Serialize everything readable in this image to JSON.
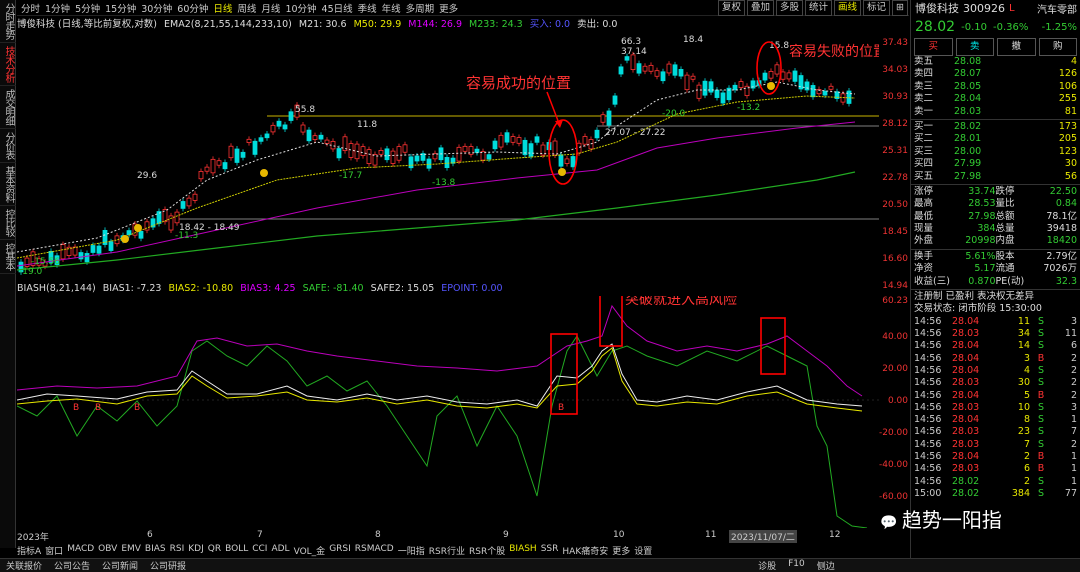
{
  "left_tabs": [
    "分时走势",
    "技术分析",
    "成交明细",
    "分价表",
    "基本资料",
    "控比较",
    "控基本"
  ],
  "top_bar": {
    "periods": [
      "分时",
      "1分钟",
      "5分钟",
      "15分钟",
      "30分钟",
      "60分钟",
      "日线",
      "周线",
      "月线",
      "10分钟",
      "45日线",
      "季线",
      "年线",
      "多周期",
      "更多"
    ],
    "active_period": "日线",
    "right_buttons": [
      "复权",
      "叠加",
      "多股",
      "统计",
      "画线",
      "标记",
      "⊞"
    ],
    "active_right": "画线"
  },
  "info_line": {
    "stock": "博俊科技 (日线,等比前复权,对数)",
    "indicator": "EMA2(8,21,55,144,233,10)",
    "m21": "M21: 30.6",
    "m50": "M50: 29.9",
    "m144": "M144: 26.9",
    "m233": "M233: 24.3",
    "x": "买入: 0.0",
    "y": "卖出: 0.0"
  },
  "k_axis": [
    "37.43",
    "34.03",
    "30.93",
    "28.12",
    "25.31",
    "22.78",
    "20.50",
    "18.45",
    "16.60",
    "14.94"
  ],
  "k_labels": {
    "p1": "55.8",
    "p2": "11.8",
    "p3": "29.6",
    "p4": "66.3",
    "p5": "37.14",
    "p6": "18.4",
    "p7": "15.8",
    "p8": "-15.56",
    "p9": "-11.3",
    "p10": "18.42 - 18.49",
    "p11": "-17.7",
    "p12": "-13.8",
    "p13": "27.07 - 27.22",
    "p14": "-20.0",
    "p15": "-13.2",
    "p16": "-19.0"
  },
  "annotations": {
    "success": "容易成功的位置",
    "fail": "容易失败的位置",
    "high_risk": "突破就进入高风险"
  },
  "ind_line": {
    "name": "BIASH(8,21,144)",
    "b1": "BIAS1: -7.23",
    "b2": "BIAS2: -10.80",
    "b3": "BIAS3: 4.25",
    "safe": "SAFE: -81.40",
    "safe2": "SAFE2: 15.05",
    "point": "EPOINT: 0.00"
  },
  "ind_axis": [
    "60.23",
    "40.00",
    "20.00",
    "0.00",
    "-20.00",
    "-40.00",
    "-60.00"
  ],
  "dates": [
    "2023年",
    "6",
    "7",
    "8",
    "9",
    "10",
    "11",
    "2023/11/07/二",
    "12"
  ],
  "bottom_tabs": [
    "指标A",
    "窗口",
    "MACD",
    "OBV",
    "EMV",
    "BIAS",
    "RSI",
    "KDJ",
    "QR",
    "BOLL",
    "CCI",
    "ADL",
    "VOL_金",
    "GRSI",
    "RSMACD",
    "一阳指",
    "RSR行业",
    "RSR个股",
    "BIASH",
    "SSR",
    "HAK痛奇安",
    "更多",
    "设置"
  ],
  "active_tab": "BIASH",
  "status_row": [
    "关联报价",
    "公司公告",
    "公司新闻",
    "公司研报",
    "诊股",
    "F10",
    "侧边"
  ],
  "quote": {
    "name": "博俊科技",
    "code": "300926",
    "flag": "L",
    "sector": "汽车零部",
    "price": "28.02",
    "change": "-0.10",
    "pct": "-0.36%",
    "sector_pct": "-1.25%",
    "buy_label": "买",
    "sell_label": "卖",
    "cancel_label": "撤",
    "cart_label": "购"
  },
  "asks": [
    {
      "l": "卖五",
      "p": "28.08",
      "v": "4"
    },
    {
      "l": "卖四",
      "p": "28.07",
      "v": "126"
    },
    {
      "l": "卖三",
      "p": "28.05",
      "v": "106"
    },
    {
      "l": "卖二",
      "p": "28.04",
      "v": "255"
    },
    {
      "l": "卖一",
      "p": "28.03",
      "v": "81"
    }
  ],
  "bids": [
    {
      "l": "买一",
      "p": "28.02",
      "v": "173"
    },
    {
      "l": "买二",
      "p": "28.01",
      "v": "205"
    },
    {
      "l": "买三",
      "p": "28.00",
      "v": "123"
    },
    {
      "l": "买四",
      "p": "27.99",
      "v": "30"
    },
    {
      "l": "买五",
      "p": "27.98",
      "v": "56"
    }
  ],
  "stats": [
    [
      "涨停",
      "33.74",
      "跌停",
      "22.50"
    ],
    [
      "最高",
      "28.53",
      "量比",
      "0.84"
    ],
    [
      "最低",
      "27.98",
      "总额",
      "78.1亿"
    ],
    [
      "现量",
      "384",
      "总量",
      "39418"
    ],
    [
      "外盘",
      "20998",
      "内盘",
      "18420"
    ]
  ],
  "stats2": [
    [
      "换手",
      "5.61%",
      "股本",
      "2.79亿"
    ],
    [
      "净资",
      "5.17",
      "流通",
      "7026万"
    ],
    [
      "收益(三)",
      "0.870",
      "PE(动)",
      "32.3"
    ]
  ],
  "reg": "注册制 已盈利 表决权无差异",
  "trade_state": "交易状态: 闭市阶段 15:30:00",
  "ticks": [
    [
      "14:56",
      "28.04",
      "11",
      "S",
      "3"
    ],
    [
      "14:56",
      "28.03",
      "34",
      "S",
      "11"
    ],
    [
      "14:56",
      "28.04",
      "14",
      "S",
      "6"
    ],
    [
      "14:56",
      "28.04",
      "3",
      "B",
      "2"
    ],
    [
      "14:56",
      "28.04",
      "4",
      "S",
      "2"
    ],
    [
      "14:56",
      "28.03",
      "30",
      "S",
      "2"
    ],
    [
      "14:56",
      "28.04",
      "5",
      "B",
      "2"
    ],
    [
      "14:56",
      "28.03",
      "10",
      "S",
      "3"
    ],
    [
      "14:56",
      "28.04",
      "8",
      "S",
      "1"
    ],
    [
      "14:56",
      "28.03",
      "23",
      "S",
      "7"
    ],
    [
      "14:56",
      "28.03",
      "7",
      "S",
      "2"
    ],
    [
      "14:56",
      "28.04",
      "2",
      "B",
      "1"
    ],
    [
      "14:56",
      "28.03",
      "6",
      "B",
      "1"
    ],
    [
      "14:56",
      "28.02",
      "2",
      "S",
      "1"
    ],
    [
      "15:00",
      "28.02",
      "384",
      "S",
      "77"
    ]
  ],
  "watermark": "趋势一阳指"
}
